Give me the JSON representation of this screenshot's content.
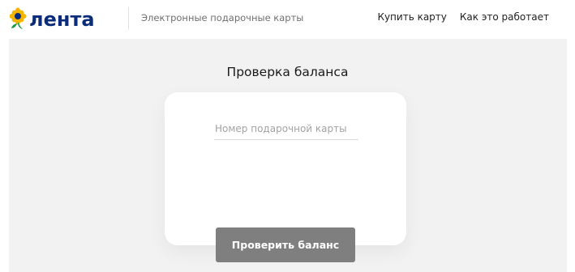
{
  "header": {
    "logo_text": "лента",
    "logo_icon": "sunflower-icon",
    "subtitle": "Электронные подарочные карты",
    "nav": [
      {
        "label": "Купить карту"
      },
      {
        "label": "Как это работает"
      }
    ]
  },
  "main": {
    "title": "Проверка баланса",
    "card_number_placeholder": "Номер подарочной карты",
    "card_number_value": "",
    "check_button_label": "Проверить баланс"
  },
  "colors": {
    "brand_blue": "#0a2c7a",
    "sunflower_yellow": "#f5b400",
    "sunflower_green": "#1f9a44",
    "page_background": "#f2f2f2",
    "button_gray": "#7f7f7f"
  }
}
